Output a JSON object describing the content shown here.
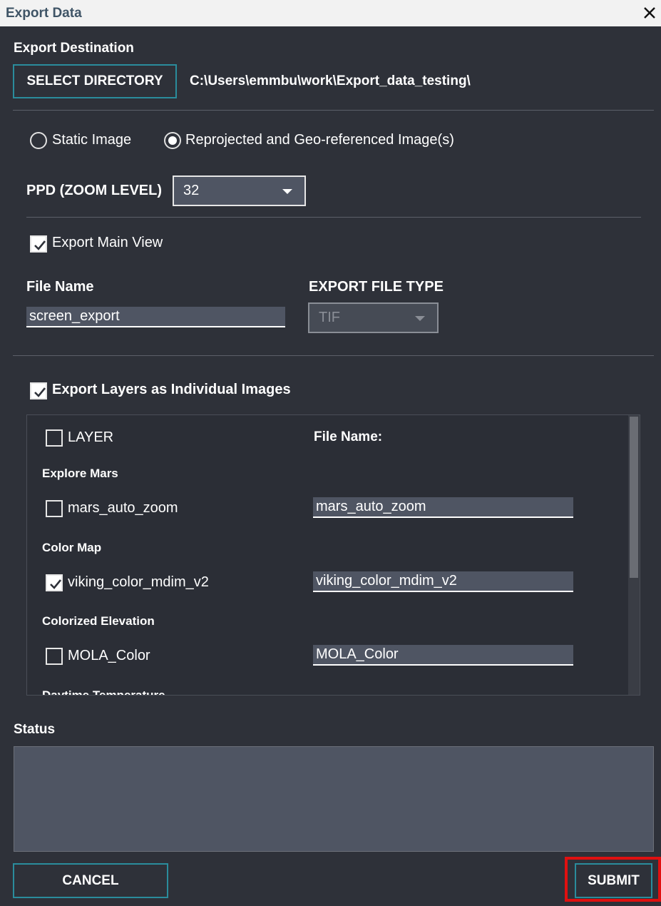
{
  "window": {
    "title": "Export Data"
  },
  "destination": {
    "heading": "Export Destination",
    "select_label": "SELECT DIRECTORY",
    "path": "C:\\Users\\emmbu\\work\\Export_data_testing\\"
  },
  "image_mode": {
    "options": [
      {
        "label": "Static Image",
        "selected": false
      },
      {
        "label": "Reprojected and Geo-referenced Image(s)",
        "selected": true
      }
    ]
  },
  "ppd": {
    "label": "PPD (ZOOM LEVEL)",
    "value": "32"
  },
  "main_view": {
    "checkbox_label": "Export Main View",
    "checked": true,
    "file_name_label": "File Name",
    "file_name_value": "screen_export",
    "file_type_label": "EXPORT FILE TYPE",
    "file_type_value": "TIF"
  },
  "layers": {
    "checkbox_label": "Export Layers as Individual Images",
    "checked": true,
    "header": {
      "layer_label": "LAYER",
      "file_name_label": "File Name:"
    },
    "groups": [
      {
        "name": "Explore Mars",
        "layer": "mars_auto_zoom",
        "file_name": "mars_auto_zoom",
        "checked": false
      },
      {
        "name": "Color Map",
        "layer": "viking_color_mdim_v2",
        "file_name": "viking_color_mdim_v2",
        "checked": true
      },
      {
        "name": "Colorized Elevation",
        "layer": "MOLA_Color",
        "file_name": "MOLA_Color",
        "checked": false
      },
      {
        "name": "Daytime Temperature"
      }
    ]
  },
  "status": {
    "label": "Status",
    "text": ""
  },
  "footer": {
    "cancel_label": "CANCEL",
    "submit_label": "SUBMIT"
  }
}
